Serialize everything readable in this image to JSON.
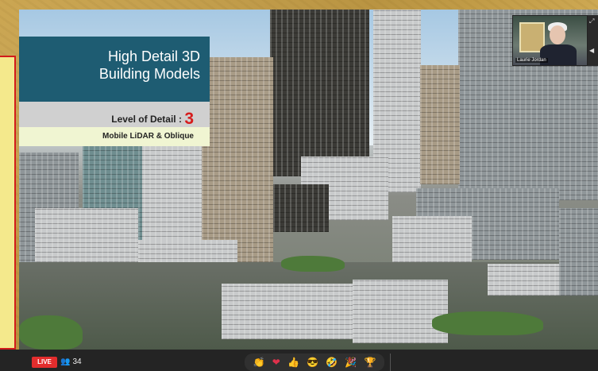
{
  "slide": {
    "title_line1": "High Detail 3D",
    "title_line2": "Building Models",
    "lod_label": "Level of Detail :",
    "lod_value": "3",
    "source_text": "Mobile LiDAR & Oblique"
  },
  "presenter": {
    "name": "Laurie Jordan"
  },
  "stream": {
    "live_label": "LIVE",
    "viewer_count": "34"
  },
  "reactions": [
    {
      "icon": "clapping-hands-icon",
      "glyph": "👏"
    },
    {
      "icon": "heart-icon",
      "glyph": "❤"
    },
    {
      "icon": "thumbs-up-icon",
      "glyph": "👍"
    },
    {
      "icon": "cool-face-icon",
      "glyph": "😎"
    },
    {
      "icon": "rofl-face-icon",
      "glyph": "🤣"
    },
    {
      "icon": "party-popper-icon",
      "glyph": "🎉"
    },
    {
      "icon": "trophy-icon",
      "glyph": "🏆"
    }
  ],
  "colors": {
    "title_bg": "#1e5c72",
    "lod_accent": "#d61c1c",
    "live_badge": "#e32d2d"
  }
}
